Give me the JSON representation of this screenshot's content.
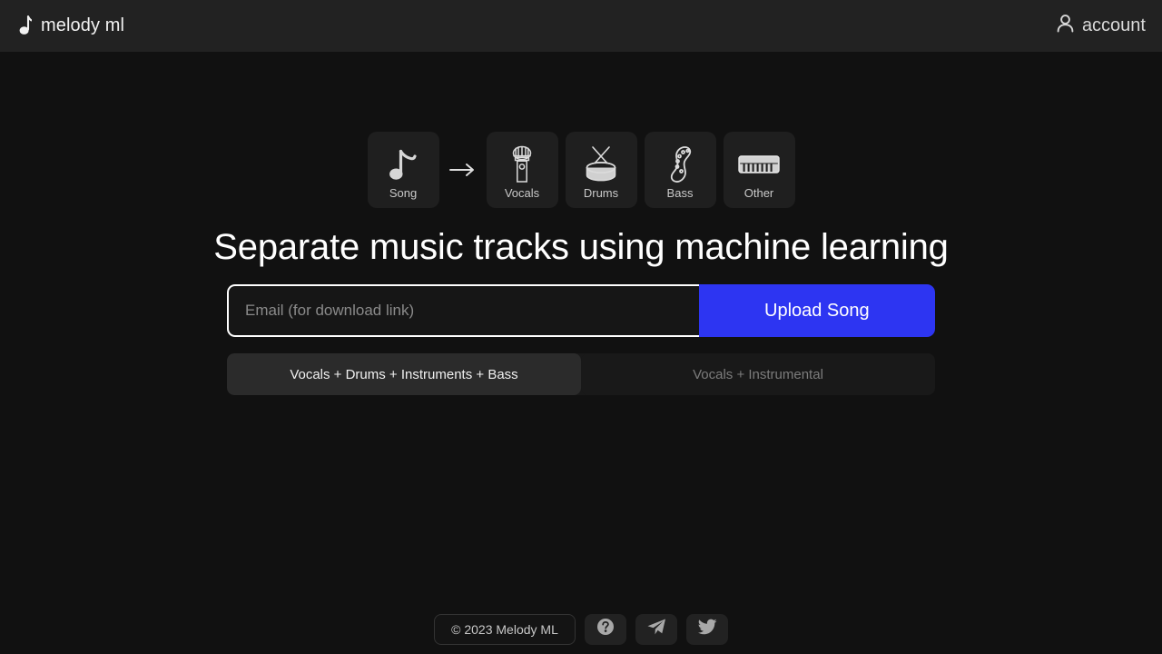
{
  "header": {
    "brand_icon": "music-note-icon",
    "brand_name": "melody ml",
    "account_icon": "user-icon",
    "account_label": "account"
  },
  "stems": {
    "arrow_glyph": "→",
    "source": {
      "label": "Song",
      "icon": "music-note-icon"
    },
    "outputs": [
      {
        "label": "Vocals",
        "icon": "microphone-icon"
      },
      {
        "label": "Drums",
        "icon": "drum-icon"
      },
      {
        "label": "Bass",
        "icon": "bass-guitar-icon"
      },
      {
        "label": "Other",
        "icon": "piano-keyboard-icon"
      }
    ]
  },
  "hero": {
    "headline": "Separate music tracks using machine learning"
  },
  "form": {
    "email_placeholder": "Email (for download link)",
    "email_value": "",
    "upload_label": "Upload Song",
    "accent_color": "#2d35f2"
  },
  "tabs": {
    "items": [
      {
        "label": "Vocals + Drums + Instruments + Bass",
        "active": true
      },
      {
        "label": "Vocals + Instrumental",
        "active": false
      }
    ]
  },
  "footer": {
    "copyright": "© 2023 Melody ML",
    "buttons": [
      {
        "name": "help-icon",
        "title": "Help"
      },
      {
        "name": "telegram-icon",
        "title": "Telegram"
      },
      {
        "name": "twitter-icon",
        "title": "Twitter"
      }
    ]
  },
  "colors": {
    "page_background": "#111111",
    "header_background": "#222222",
    "card_background": "#1f1f1f",
    "accent": "#2d35f2",
    "tab_active": "#2b2b2b",
    "tab_inactive": "#191919"
  }
}
